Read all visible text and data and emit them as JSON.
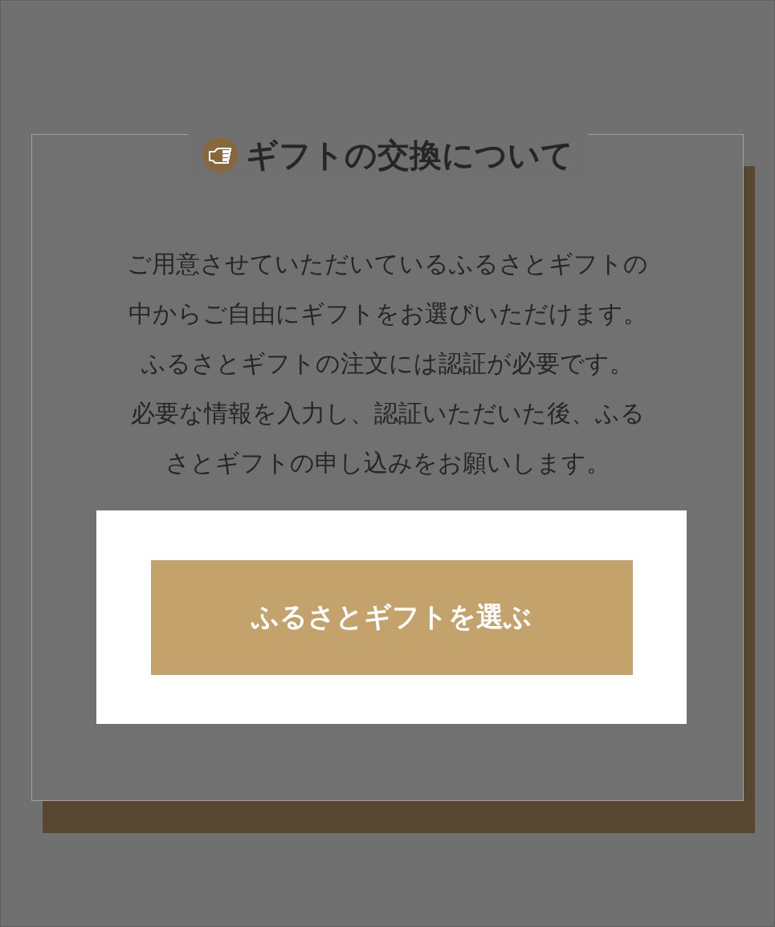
{
  "dialog": {
    "title": "ギフトの交換について",
    "paragraphs": [
      "ご用意させていただいているふるさとギフトの中からご自由にギフトをお選びいただけます。",
      "ふるさとギフトの注文には認証が必要です。",
      "必要な情報を入力し、認証いただいた後、ふるさとギフトの申し込みをお願いします。"
    ],
    "button": "ふるさとギフトを選ぶ"
  }
}
